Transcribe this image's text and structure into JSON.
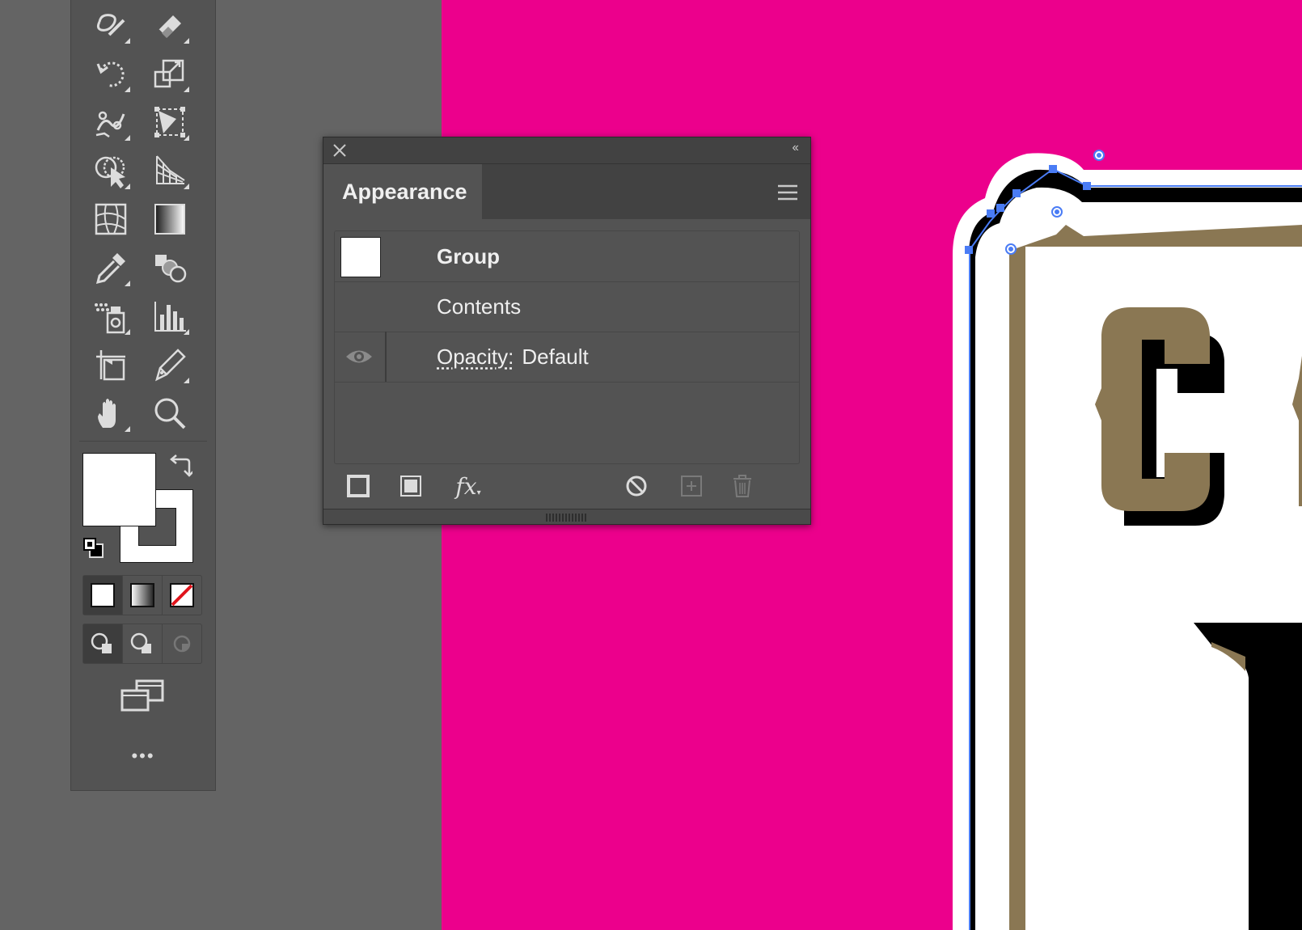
{
  "canvas": {
    "artboard_color": "#ec008c",
    "brown": "#8a7753"
  },
  "toolbar": {
    "tools": [
      [
        "shaper-icon",
        "eraser-icon"
      ],
      [
        "rotate-icon",
        "scale-icon"
      ],
      [
        "puppet-warp-icon",
        "free-transform-icon"
      ],
      [
        "shape-builder-icon",
        "perspective-grid-icon"
      ],
      [
        "mesh-icon",
        "gradient-icon"
      ],
      [
        "eyedropper-icon",
        "blend-icon"
      ],
      [
        "symbol-sprayer-icon",
        "column-graph-icon"
      ],
      [
        "artboard-icon",
        "slice-icon"
      ],
      [
        "hand-icon",
        "zoom-icon"
      ]
    ],
    "more_label": "•••"
  },
  "appearance_panel": {
    "tab_label": "Appearance",
    "rows": {
      "group": "Group",
      "contents": "Contents",
      "opacity_link": "Opacity:",
      "opacity_value": "Default"
    },
    "footer": [
      "add-stroke-icon",
      "add-fill-icon",
      "fx-icon",
      "clear-appearance-icon",
      "duplicate-item-icon",
      "delete-item-icon"
    ],
    "fx_label": "fx"
  }
}
